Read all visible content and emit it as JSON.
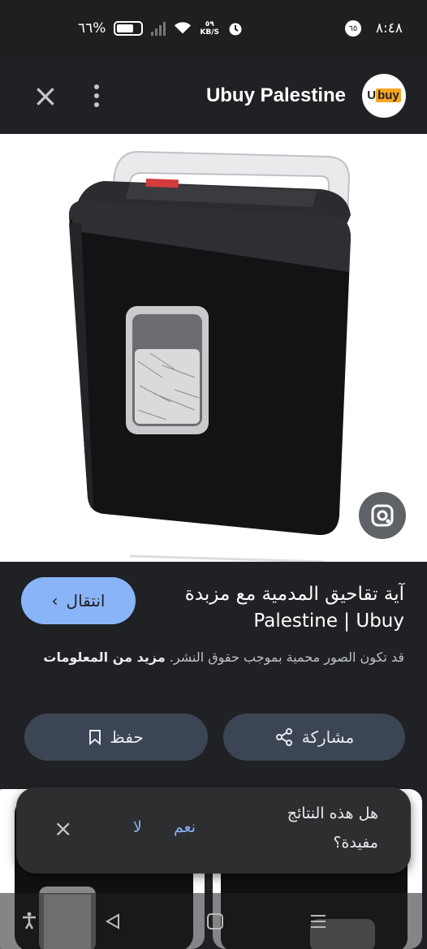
{
  "status_bar": {
    "time": "٨:٤٨",
    "notification_count": "٦٥",
    "speed_value": "٥٩",
    "speed_unit": "KB/S",
    "battery": "٦٦%"
  },
  "header": {
    "title": "Ubuy Palestine",
    "logo_text_1": "U",
    "logo_text_2": "buy",
    "close_icon": "close-icon",
    "menu_icon": "more-vert-icon"
  },
  "result": {
    "title": "آية تقاحيق المدمية مع مزبدة Palestine | Ubuy",
    "visit_label": "انتقال",
    "copyright_text": "قد تكون الصور محمية بموجب حقوق النشر.",
    "more_info": "مزيد من المعلومات"
  },
  "actions": {
    "share_label": "مشاركة",
    "save_label": "حفظ"
  },
  "feedback": {
    "question": "هل هذه النتائج مفيدة؟",
    "yes": "نعم",
    "no": "لا"
  },
  "colors": {
    "accent": "#8ab4f8",
    "pill_bg": "#3c4554",
    "background": "#202124"
  }
}
